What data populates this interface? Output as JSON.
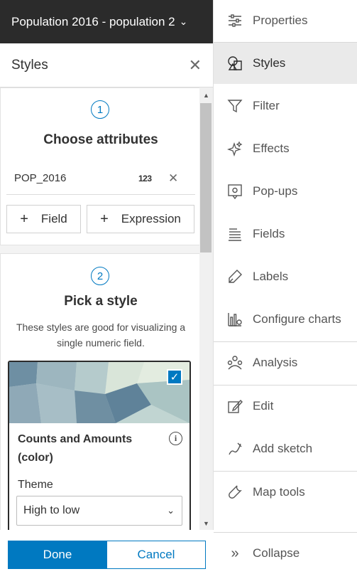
{
  "layer_header": {
    "title": "Population 2016 - population 2",
    "chevron": "⌄"
  },
  "panel": {
    "title": "Styles",
    "close": "✕"
  },
  "step1": {
    "number": "1",
    "title": "Choose attributes",
    "attribute": {
      "name": "POP_2016",
      "type_badge": "123",
      "remove": "✕"
    },
    "add_field_label": "Field",
    "add_expression_label": "Expression",
    "plus": "+"
  },
  "step2": {
    "number": "2",
    "title": "Pick a style",
    "description": "These styles are good for visualizing a single numeric field.",
    "style_card": {
      "title": "Counts and Amounts (color)",
      "info": "i",
      "checked": "✓",
      "theme_label": "Theme",
      "theme_value": "High to low",
      "chevron": "⌄"
    }
  },
  "footer": {
    "done_label": "Done",
    "cancel_label": "Cancel"
  },
  "nav": {
    "properties": "Properties",
    "styles": "Styles",
    "filter": "Filter",
    "effects": "Effects",
    "popups": "Pop-ups",
    "fields": "Fields",
    "labels": "Labels",
    "configure_charts": "Configure charts",
    "analysis": "Analysis",
    "edit": "Edit",
    "add_sketch": "Add sketch",
    "map_tools": "Map tools",
    "collapse": "Collapse",
    "collapse_glyph": "»"
  },
  "colors": {
    "accent": "#0079c1",
    "header_bg": "#2b2b2b",
    "active_nav": "#eaeaea"
  }
}
